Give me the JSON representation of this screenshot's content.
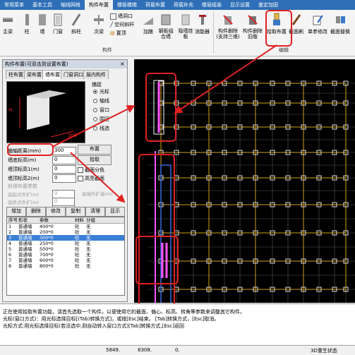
{
  "tabs": [
    "常用菜单",
    "基本工具",
    "轴线网格",
    "构件布置",
    "楼板楼梯",
    "荷载布置",
    "荷载补充",
    "楼层组装",
    "显示设置",
    "鉴定加固"
  ],
  "active_tab_index": 3,
  "ribbon": {
    "buttons": {
      "zhu": "主梁",
      "zhu2": "柱",
      "qiang": "墙",
      "menchuang": "门窗",
      "liangxie": "斜柱",
      "ciliang": "次梁",
      "jiamu": "加腋",
      "gangban": "钢板组合墙",
      "yinban": "隐墙挂板",
      "xiaoshi": "消能器",
      "goujian_edit": "构件删除(支持三维)",
      "goujian_del": "构件删除旧版",
      "pick": "拾取布置",
      "copy": "截面刷",
      "single": "单参修改",
      "replace": "截面替换"
    },
    "small": {
      "quanmen": "墙洞口",
      "kongjian": "空间斜杆",
      "zhiding": "置顶"
    },
    "groups": {
      "goujian": "构件",
      "bianji": "编辑"
    }
  },
  "panel": {
    "title": "构件布置(可双击到设置布置)",
    "tabs": [
      "柱布置",
      "梁布置",
      "墙布置",
      "门窗洞口",
      "层内构件"
    ],
    "selected_tab": 2,
    "capture_label": "捕捉",
    "capture_options": [
      "光标",
      "轴线",
      "窗口",
      "围区",
      "线选"
    ],
    "capture_selected": 0,
    "preview_dim": "300",
    "fields": [
      {
        "label": "偏轴距离(mm)",
        "value": "300"
      },
      {
        "label": "墙底标高(m)",
        "value": "0"
      },
      {
        "label": "墙顶标高1(m)",
        "value": "0"
      },
      {
        "label": "墙顶标高2(m)",
        "value": "0"
      }
    ],
    "buttons": {
      "buzhi": "布置",
      "shiqu": "拾取"
    },
    "checks": {
      "jiemian": "截面分色",
      "gaoliang": "高亮截面"
    },
    "slant_group": "斜墙布置参数",
    "slant_fields": [
      {
        "label": "底起点外扩(m)",
        "value": "0"
      },
      {
        "label": "底终点外扩(m)",
        "value": "0"
      },
      {
        "label": "顶起点外扩(m)",
        "value": "0"
      }
    ],
    "slant_right_label": "底端外扩高(m)",
    "actions": [
      "增加",
      "删除",
      "修改",
      "复制",
      "清理",
      "显示"
    ],
    "table": {
      "headers": [
        "序号",
        "形状",
        "参数",
        "材料",
        "分组"
      ],
      "rows": [
        [
          "1",
          "普通墙",
          "400*0",
          "砼",
          "无"
        ],
        [
          "2",
          "普通墙",
          "200*0",
          "砼",
          "无"
        ],
        [
          "3",
          "普通墙",
          "300*0",
          "砼",
          "无"
        ],
        [
          "4",
          "普通墙",
          "250*0",
          "砼",
          "无"
        ],
        [
          "5",
          "普通墙",
          "500*0",
          "砼",
          "无"
        ],
        [
          "6",
          "普通墙",
          "700*0",
          "砼",
          "无"
        ],
        [
          "7",
          "普通墙",
          "600*0",
          "砼",
          "无"
        ],
        [
          "8",
          "普通墙",
          "800*0",
          "砼",
          "无"
        ]
      ],
      "selected_row": 2
    }
  },
  "command": {
    "line1": "正在使用拾取布置功能，请首先选取一个构件，以便使用它的截面、偏心、标高、转角等参数来调整其它构件。",
    "line2": "光标(窗口方式)：用光标选择目标[(Tab)转换方式]，或按[Esc]结束。 [Tab]转换方式，[Esc]取消。",
    "line3": "光标方式:用光标选择目标(若没选中,则自动转入窗口方式)[Tab]转换方式,[Esc]返回"
  },
  "statusbar": {
    "x": "5849.",
    "y": "8308.",
    "z": "0.",
    "right": "3D重生状态"
  },
  "colors": {
    "tab_bg": "#2e6fb7",
    "highlight": "#e02020",
    "canvas_bg": "#000000",
    "wall": "#ff55ff",
    "selected_row": "#3c7fd6"
  }
}
